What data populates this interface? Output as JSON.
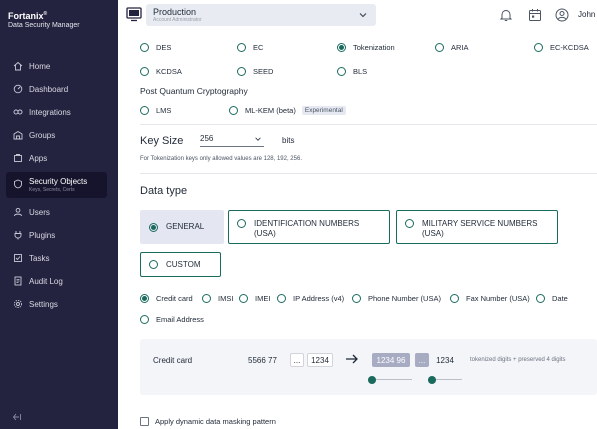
{
  "sidebar": {
    "brand": "Fortanix",
    "brand_mark": "®",
    "brand_sub": "Data Security Manager",
    "items": [
      {
        "label": "Home",
        "icon": "home-icon"
      },
      {
        "label": "Dashboard",
        "icon": "dashboard-icon"
      },
      {
        "label": "Integrations",
        "icon": "integrations-icon"
      },
      {
        "label": "Groups",
        "icon": "groups-icon"
      },
      {
        "label": "Apps",
        "icon": "apps-icon"
      },
      {
        "label": "Security Objects",
        "sub": "Keys, Secrets, Certs",
        "icon": "security-objects-icon",
        "active": true
      },
      {
        "label": "Users",
        "icon": "users-icon"
      },
      {
        "label": "Plugins",
        "icon": "plugins-icon"
      },
      {
        "label": "Tasks",
        "icon": "tasks-icon"
      },
      {
        "label": "Audit Log",
        "icon": "audit-log-icon"
      },
      {
        "label": "Settings",
        "icon": "settings-icon"
      }
    ]
  },
  "header": {
    "environment": "Production",
    "environment_sub": "Account Administrator",
    "user_name": "John"
  },
  "algorithms": {
    "row1": [
      "DES",
      "EC",
      "Tokenization",
      "ARIA",
      "EC-KCDSA"
    ],
    "row2": [
      "KCDSA",
      "SEED",
      "BLS"
    ],
    "selected": "Tokenization",
    "pqc_title": "Post Quantum Cryptography",
    "pqc": [
      "LMS",
      "ML-KEM (beta)"
    ],
    "pqc_badge": "Experimental"
  },
  "key_size": {
    "label": "Key Size",
    "value": "256",
    "unit": "bits",
    "hint": "For Tokenization keys only allowed values are 128, 192, 256."
  },
  "data_type": {
    "title": "Data type",
    "cards": [
      "GENERAL",
      "IDENTIFICATION NUMBERS (USA)",
      "MILITARY SERVICE NUMBERS (USA)",
      "CUSTOM"
    ],
    "selected_card": "GENERAL",
    "formats": [
      "Credit card",
      "IMSI",
      "IMEI",
      "IP Address (v4)",
      "Phone Number (USA)",
      "Fax Number (USA)",
      "Date",
      "Email Address"
    ],
    "selected_format": "Credit card"
  },
  "mask_preview": {
    "label": "Credit card",
    "original_prefix": "5566 77",
    "original_dots": "...",
    "original_suffix": "1234",
    "token_prefix": "1234 96",
    "token_dots": "...",
    "token_suffix": "1234",
    "note": "tokenized digits + preserved 4 digits"
  },
  "dynamic_masking_label": "Apply dynamic data masking pattern",
  "colors": {
    "sidebar_bg": "#24233f",
    "accent": "#1a6b5e",
    "selected_card_bg": "#e4e7f1"
  }
}
